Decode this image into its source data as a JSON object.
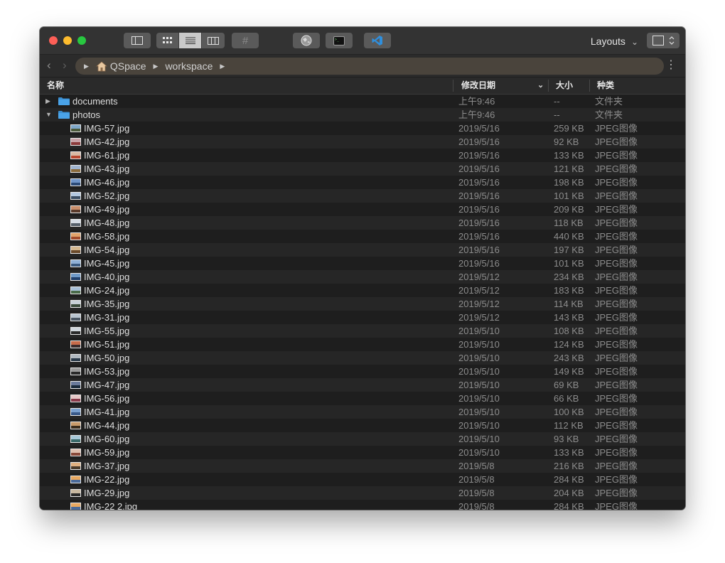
{
  "toolbar": {
    "layouts_label": "Layouts",
    "hash_label": "#"
  },
  "pathbar": {
    "crumbs": [
      "QSpace",
      "workspace"
    ]
  },
  "columns": {
    "name": "名称",
    "date": "修改日期",
    "size": "大小",
    "kind": "种类"
  },
  "rows": [
    {
      "type": "folder",
      "expanded": false,
      "name": "documents",
      "date": "上午9:46",
      "size": "--",
      "kind": "文件夹"
    },
    {
      "type": "folder",
      "expanded": true,
      "name": "photos",
      "date": "上午9:46",
      "size": "--",
      "kind": "文件夹"
    },
    {
      "type": "file",
      "name": "IMG-57.jpg",
      "date": "2019/5/16",
      "size": "259 KB",
      "kind": "JPEG图像",
      "thumb": [
        "#7fa7c9",
        "#4b5a3b"
      ]
    },
    {
      "type": "file",
      "name": "IMG-42.jpg",
      "date": "2019/5/16",
      "size": "92 KB",
      "kind": "JPEG图像",
      "thumb": [
        "#c9a3a8",
        "#8c3b3b"
      ]
    },
    {
      "type": "file",
      "name": "IMG-61.jpg",
      "date": "2019/5/16",
      "size": "133 KB",
      "kind": "JPEG图像",
      "thumb": [
        "#d9b9a3",
        "#b8472e"
      ]
    },
    {
      "type": "file",
      "name": "IMG-43.jpg",
      "date": "2019/5/16",
      "size": "121 KB",
      "kind": "JPEG图像",
      "thumb": [
        "#9fb4cf",
        "#8a6a3a"
      ]
    },
    {
      "type": "file",
      "name": "IMG-46.jpg",
      "date": "2019/5/16",
      "size": "198 KB",
      "kind": "JPEG图像",
      "thumb": [
        "#7095c9",
        "#2c4b78"
      ]
    },
    {
      "type": "file",
      "name": "IMG-52.jpg",
      "date": "2019/5/16",
      "size": "101 KB",
      "kind": "JPEG图像",
      "thumb": [
        "#b3c8e0",
        "#3a4d63"
      ]
    },
    {
      "type": "file",
      "name": "IMG-49.jpg",
      "date": "2019/5/16",
      "size": "209 KB",
      "kind": "JPEG图像",
      "thumb": [
        "#c98e6b",
        "#5a3a2a"
      ]
    },
    {
      "type": "file",
      "name": "IMG-48.jpg",
      "date": "2019/5/16",
      "size": "118 KB",
      "kind": "JPEG图像",
      "thumb": [
        "#d6dde6",
        "#56606b"
      ]
    },
    {
      "type": "file",
      "name": "IMG-58.jpg",
      "date": "2019/5/16",
      "size": "440 KB",
      "kind": "JPEG图像",
      "thumb": [
        "#e0a36b",
        "#a14a2a"
      ]
    },
    {
      "type": "file",
      "name": "IMG-54.jpg",
      "date": "2019/5/16",
      "size": "197 KB",
      "kind": "JPEG图像",
      "thumb": [
        "#d4b890",
        "#6b4a2a"
      ]
    },
    {
      "type": "file",
      "name": "IMG-45.jpg",
      "date": "2019/5/16",
      "size": "101 KB",
      "kind": "JPEG图像",
      "thumb": [
        "#8fb0d6",
        "#3a5a80"
      ]
    },
    {
      "type": "file",
      "name": "IMG-40.jpg",
      "date": "2019/5/12",
      "size": "234 KB",
      "kind": "JPEG图像",
      "thumb": [
        "#6f9ac8",
        "#1f3f6b"
      ]
    },
    {
      "type": "file",
      "name": "IMG-24.jpg",
      "date": "2019/5/12",
      "size": "183 KB",
      "kind": "JPEG图像",
      "thumb": [
        "#a8c0d8",
        "#4a6b4a"
      ]
    },
    {
      "type": "file",
      "name": "IMG-35.jpg",
      "date": "2019/5/12",
      "size": "114 KB",
      "kind": "JPEG图像",
      "thumb": [
        "#c8d0d6",
        "#3a4a3a"
      ]
    },
    {
      "type": "file",
      "name": "IMG-31.jpg",
      "date": "2019/5/12",
      "size": "143 KB",
      "kind": "JPEG图像",
      "thumb": [
        "#b8c4cf",
        "#4a5663"
      ]
    },
    {
      "type": "file",
      "name": "IMG-55.jpg",
      "date": "2019/5/10",
      "size": "108 KB",
      "kind": "JPEG图像",
      "thumb": [
        "#d0d6dc",
        "#2a2a2a"
      ]
    },
    {
      "type": "file",
      "name": "IMG-51.jpg",
      "date": "2019/5/10",
      "size": "124 KB",
      "kind": "JPEG图像",
      "thumb": [
        "#c86b4a",
        "#3a2a2a"
      ]
    },
    {
      "type": "file",
      "name": "IMG-50.jpg",
      "date": "2019/5/10",
      "size": "243 KB",
      "kind": "JPEG图像",
      "thumb": [
        "#b0b8c0",
        "#2a3a4a"
      ]
    },
    {
      "type": "file",
      "name": "IMG-53.jpg",
      "date": "2019/5/10",
      "size": "149 KB",
      "kind": "JPEG图像",
      "thumb": [
        "#9a9a9a",
        "#2a2a2a"
      ]
    },
    {
      "type": "file",
      "name": "IMG-47.jpg",
      "date": "2019/5/10",
      "size": "69 KB",
      "kind": "JPEG图像",
      "thumb": [
        "#6a7a9a",
        "#1a2a3a"
      ]
    },
    {
      "type": "file",
      "name": "IMG-56.jpg",
      "date": "2019/5/10",
      "size": "66 KB",
      "kind": "JPEG图像",
      "thumb": [
        "#e6c8c8",
        "#8a3a4a"
      ]
    },
    {
      "type": "file",
      "name": "IMG-41.jpg",
      "date": "2019/5/10",
      "size": "100 KB",
      "kind": "JPEG图像",
      "thumb": [
        "#7aa0cf",
        "#3a5a8a"
      ]
    },
    {
      "type": "file",
      "name": "IMG-44.jpg",
      "date": "2019/5/10",
      "size": "112 KB",
      "kind": "JPEG图像",
      "thumb": [
        "#c89a6a",
        "#3a2a1a"
      ]
    },
    {
      "type": "file",
      "name": "IMG-60.jpg",
      "date": "2019/5/10",
      "size": "93 KB",
      "kind": "JPEG图像",
      "thumb": [
        "#a8c8d8",
        "#3a6a6a"
      ]
    },
    {
      "type": "file",
      "name": "IMG-59.jpg",
      "date": "2019/5/10",
      "size": "133 KB",
      "kind": "JPEG图像",
      "thumb": [
        "#e0c0b0",
        "#8a4a3a"
      ]
    },
    {
      "type": "file",
      "name": "IMG-37.jpg",
      "date": "2019/5/8",
      "size": "216 KB",
      "kind": "JPEG图像",
      "thumb": [
        "#e0b080",
        "#4a3a2a"
      ]
    },
    {
      "type": "file",
      "name": "IMG-22.jpg",
      "date": "2019/5/8",
      "size": "284 KB",
      "kind": "JPEG图像",
      "thumb": [
        "#e8a860",
        "#4a6a9a"
      ]
    },
    {
      "type": "file",
      "name": "IMG-29.jpg",
      "date": "2019/5/8",
      "size": "204 KB",
      "kind": "JPEG图像",
      "thumb": [
        "#c8b8a0",
        "#2a2a2a"
      ]
    },
    {
      "type": "file",
      "name": "IMG-22 2.jpg",
      "date": "2019/5/8",
      "size": "284 KB",
      "kind": "JPEG图像",
      "thumb": [
        "#e8a860",
        "#4a6a9a"
      ]
    }
  ],
  "colors": {
    "folder": "#4aa3e8",
    "folder_tab": "#3b8ed0"
  }
}
